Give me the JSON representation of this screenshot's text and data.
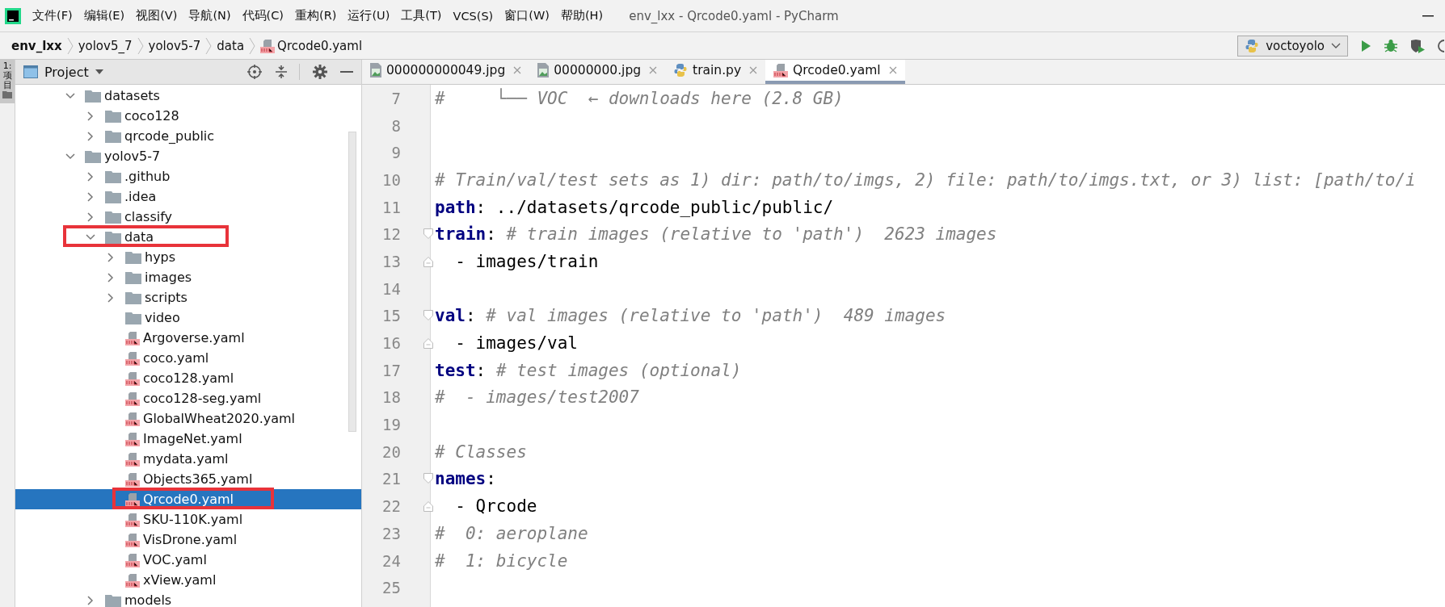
{
  "menu": [
    "文件(F)",
    "编辑(E)",
    "视图(V)",
    "导航(N)",
    "代码(C)",
    "重构(R)",
    "运行(U)",
    "工具(T)",
    "VCS(S)",
    "窗口(W)",
    "帮助(H)"
  ],
  "window": {
    "title": "env_lxx - Qrcode0.yaml - PyCharm"
  },
  "breadcrumbs": [
    {
      "label": "env_lxx",
      "kind": "root"
    },
    {
      "label": "yolov5_7",
      "kind": "folder"
    },
    {
      "label": "yolov5-7",
      "kind": "folder"
    },
    {
      "label": "data",
      "kind": "folder"
    },
    {
      "label": "Qrcode0.yaml",
      "kind": "yaml"
    }
  ],
  "run_config": {
    "value": "voctoyolo"
  },
  "side_strip": {
    "label": "1:项目"
  },
  "project_panel": {
    "title": "Project"
  },
  "tree": [
    {
      "label": "datasets",
      "kind": "folder",
      "expanded": true,
      "selected": false,
      "children": [
        {
          "label": "coco128",
          "kind": "folder",
          "expanded": false,
          "selected": false
        },
        {
          "label": "qrcode_public",
          "kind": "folder",
          "expanded": false,
          "selected": false
        }
      ]
    },
    {
      "label": "yolov5-7",
      "kind": "folder",
      "expanded": true,
      "selected": false,
      "children": [
        {
          "label": ".github",
          "kind": "folder",
          "expanded": false,
          "selected": false
        },
        {
          "label": ".idea",
          "kind": "folder",
          "expanded": false,
          "selected": false
        },
        {
          "label": "classify",
          "kind": "folder",
          "expanded": false,
          "selected": false
        },
        {
          "label": "data",
          "kind": "folder",
          "expanded": true,
          "selected": false,
          "annotated": true,
          "children": [
            {
              "label": "hyps",
              "kind": "folder",
              "expanded": false,
              "selected": false
            },
            {
              "label": "images",
              "kind": "folder",
              "expanded": false,
              "selected": false
            },
            {
              "label": "scripts",
              "kind": "folder",
              "expanded": false,
              "selected": false
            },
            {
              "label": "video",
              "kind": "folder",
              "selected": false
            },
            {
              "label": "Argoverse.yaml",
              "kind": "yaml",
              "selected": false
            },
            {
              "label": "coco.yaml",
              "kind": "yaml",
              "selected": false
            },
            {
              "label": "coco128.yaml",
              "kind": "yaml",
              "selected": false
            },
            {
              "label": "coco128-seg.yaml",
              "kind": "yaml",
              "selected": false
            },
            {
              "label": "GlobalWheat2020.yaml",
              "kind": "yaml",
              "selected": false
            },
            {
              "label": "ImageNet.yaml",
              "kind": "yaml",
              "selected": false
            },
            {
              "label": "mydata.yaml",
              "kind": "yaml",
              "selected": false
            },
            {
              "label": "Objects365.yaml",
              "kind": "yaml",
              "selected": false
            },
            {
              "label": "Qrcode0.yaml",
              "kind": "yaml",
              "selected": true,
              "annotated": true
            },
            {
              "label": "SKU-110K.yaml",
              "kind": "yaml",
              "selected": false
            },
            {
              "label": "VisDrone.yaml",
              "kind": "yaml",
              "selected": false
            },
            {
              "label": "VOC.yaml",
              "kind": "yaml",
              "selected": false
            },
            {
              "label": "xView.yaml",
              "kind": "yaml",
              "selected": false
            }
          ]
        },
        {
          "label": "models",
          "kind": "folder",
          "expanded": false,
          "selected": false
        }
      ]
    }
  ],
  "tabs": [
    {
      "label": "000000000049.jpg",
      "kind": "image",
      "selected": false
    },
    {
      "label": "00000000.jpg",
      "kind": "image",
      "selected": false
    },
    {
      "label": "train.py",
      "kind": "python",
      "selected": false
    },
    {
      "label": "Qrcode0.yaml",
      "kind": "yaml",
      "selected": true
    }
  ],
  "editor": {
    "lines": [
      {
        "number": "7",
        "segments": [
          {
            "kind": "comment",
            "text": "#     └── VOC  ← downloads here (2.8 GB)"
          }
        ]
      },
      {
        "number": "8"
      },
      {
        "number": "9"
      },
      {
        "number": "10",
        "segments": [
          {
            "kind": "comment",
            "text": "# Train/val/test sets as 1) dir: path/to/imgs, 2) file: path/to/imgs.txt, or 3) list: [path/to/i"
          }
        ]
      },
      {
        "number": "11",
        "segments": [
          {
            "kind": "key",
            "text": "path"
          },
          {
            "kind": "text",
            "text": ": ../datasets/qrcode_public/public/"
          }
        ]
      },
      {
        "number": "12",
        "kind": "fold_start",
        "segments": [
          {
            "kind": "key",
            "text": "train"
          },
          {
            "kind": "text",
            "text": ": "
          },
          {
            "kind": "comment",
            "text": "# train images (relative to 'path')  2623 images"
          }
        ]
      },
      {
        "number": "13",
        "kind": "fold_end",
        "segments": [
          {
            "kind": "text",
            "text": "  - images/train"
          }
        ]
      },
      {
        "number": "14"
      },
      {
        "number": "15",
        "kind": "fold_start",
        "segments": [
          {
            "kind": "key",
            "text": "val"
          },
          {
            "kind": "text",
            "text": ": "
          },
          {
            "kind": "comment",
            "text": "# val images (relative to 'path')  489 images"
          }
        ]
      },
      {
        "number": "16",
        "kind": "fold_end",
        "segments": [
          {
            "kind": "text",
            "text": "  - images/val"
          }
        ]
      },
      {
        "number": "17",
        "segments": [
          {
            "kind": "key",
            "text": "test"
          },
          {
            "kind": "text",
            "text": ": "
          },
          {
            "kind": "comment",
            "text": "# test images (optional)"
          }
        ]
      },
      {
        "number": "18",
        "segments": [
          {
            "kind": "comment",
            "text": "#  - images/test2007"
          }
        ]
      },
      {
        "number": "19"
      },
      {
        "number": "20",
        "segments": [
          {
            "kind": "comment",
            "text": "# Classes"
          }
        ]
      },
      {
        "number": "21",
        "kind": "fold_start",
        "segments": [
          {
            "kind": "key",
            "text": "names"
          },
          {
            "kind": "text",
            "text": ":"
          }
        ]
      },
      {
        "number": "22",
        "kind": "fold_end",
        "segments": [
          {
            "kind": "text",
            "text": "  - Qrcode"
          }
        ]
      },
      {
        "number": "23",
        "segments": [
          {
            "kind": "comment",
            "text": "#  0: aeroplane"
          }
        ]
      },
      {
        "number": "24",
        "segments": [
          {
            "kind": "comment",
            "text": "#  1: bicycle"
          }
        ]
      },
      {
        "number": "25"
      }
    ]
  }
}
